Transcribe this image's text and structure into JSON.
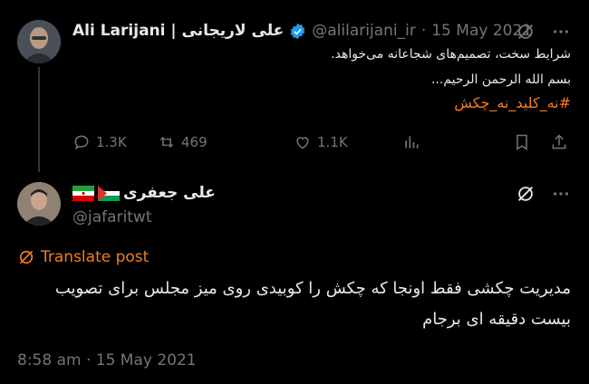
{
  "colors": {
    "background": "#000000",
    "text": "#e7e9ea",
    "muted": "#71767b",
    "accent": "#f47c22",
    "verified": "#1d9bf0"
  },
  "quoted_tweet": {
    "author_name": "Ali Larijani | علی لاریجانی",
    "verified_icon": "verified-badge-icon",
    "handle": "@alilarijani_ir",
    "separator": "·",
    "date": "15 May 2021",
    "lines": [
      "شرایط سخت، تصمیم‌های شجاعانه می‌خواهد.",
      "بسم الله الرحمن الرحیم..."
    ],
    "hashtag": "#نه_کلید_نه_چکش",
    "actions": {
      "replies": "1.3K",
      "retweets": "469",
      "likes": "1.1K"
    }
  },
  "reply_tweet": {
    "author_name": "علی جعفری",
    "flags": [
      "palestine-flag-icon",
      "iran-flag-icon"
    ],
    "handle": "@jafaritwt",
    "translate_label": "Translate post",
    "text": "مدیریت چکشی فقط اونجا که چکش را کوبیدی روی میز مجلس برای تصویب بیست دقیقه ای برجام",
    "timestamp": "8:58 am · 15 May 2021"
  }
}
